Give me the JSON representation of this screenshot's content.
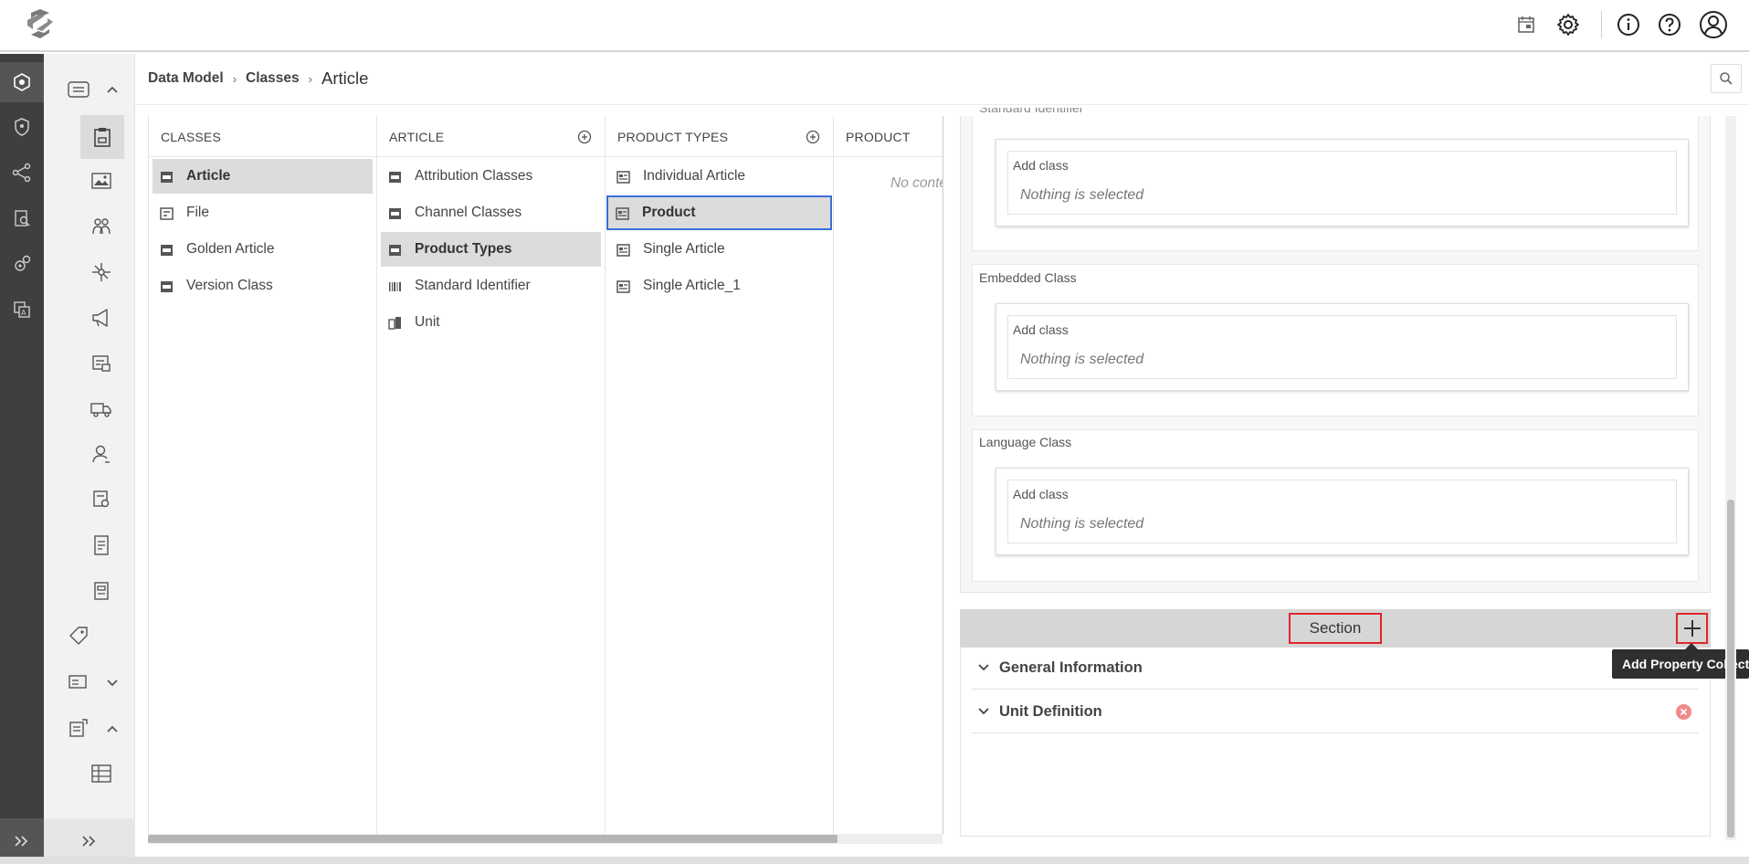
{
  "app": {
    "logo": "app-logo",
    "top_icons": [
      "calendar-icon",
      "settings-gear-icon",
      "info-icon",
      "help-icon",
      "user-profile-icon"
    ]
  },
  "breadcrumb": {
    "items": [
      "Data Model",
      "Classes"
    ],
    "current": "Article"
  },
  "columns": {
    "classes": {
      "header": "CLASSES",
      "items": [
        "Article",
        "File",
        "Golden Article",
        "Version Class"
      ],
      "selected": "Article"
    },
    "article": {
      "header": "ARTICLE",
      "items": [
        "Attribution Classes",
        "Channel Classes",
        "Product Types",
        "Standard Identifier",
        "Unit"
      ],
      "selected": "Product Types"
    },
    "product_types": {
      "header": "PRODUCT TYPES",
      "items": [
        "Individual Article",
        "Product",
        "Single Article",
        "Single Article_1"
      ],
      "selected": "Product"
    },
    "product": {
      "header": "PRODUCT",
      "empty_text": "No content"
    }
  },
  "class_fields": [
    {
      "label": "Standard Identifier",
      "add_label": "Add class",
      "value": "Nothing is selected"
    },
    {
      "label": "Embedded Class",
      "add_label": "Add class",
      "value": "Nothing is selected"
    },
    {
      "label": "Language Class",
      "add_label": "Add class",
      "value": "Nothing is selected"
    }
  ],
  "section": {
    "title": "Section",
    "add_tooltip": "Add Property Collection",
    "collections": [
      "General Information",
      "Unit Definition"
    ]
  },
  "colors": {
    "rail_bg": "#3f3f3f",
    "highlight_border": "#e0262b",
    "focus_border": "#3b6fd8",
    "remove_icon": "#f08a8a"
  }
}
